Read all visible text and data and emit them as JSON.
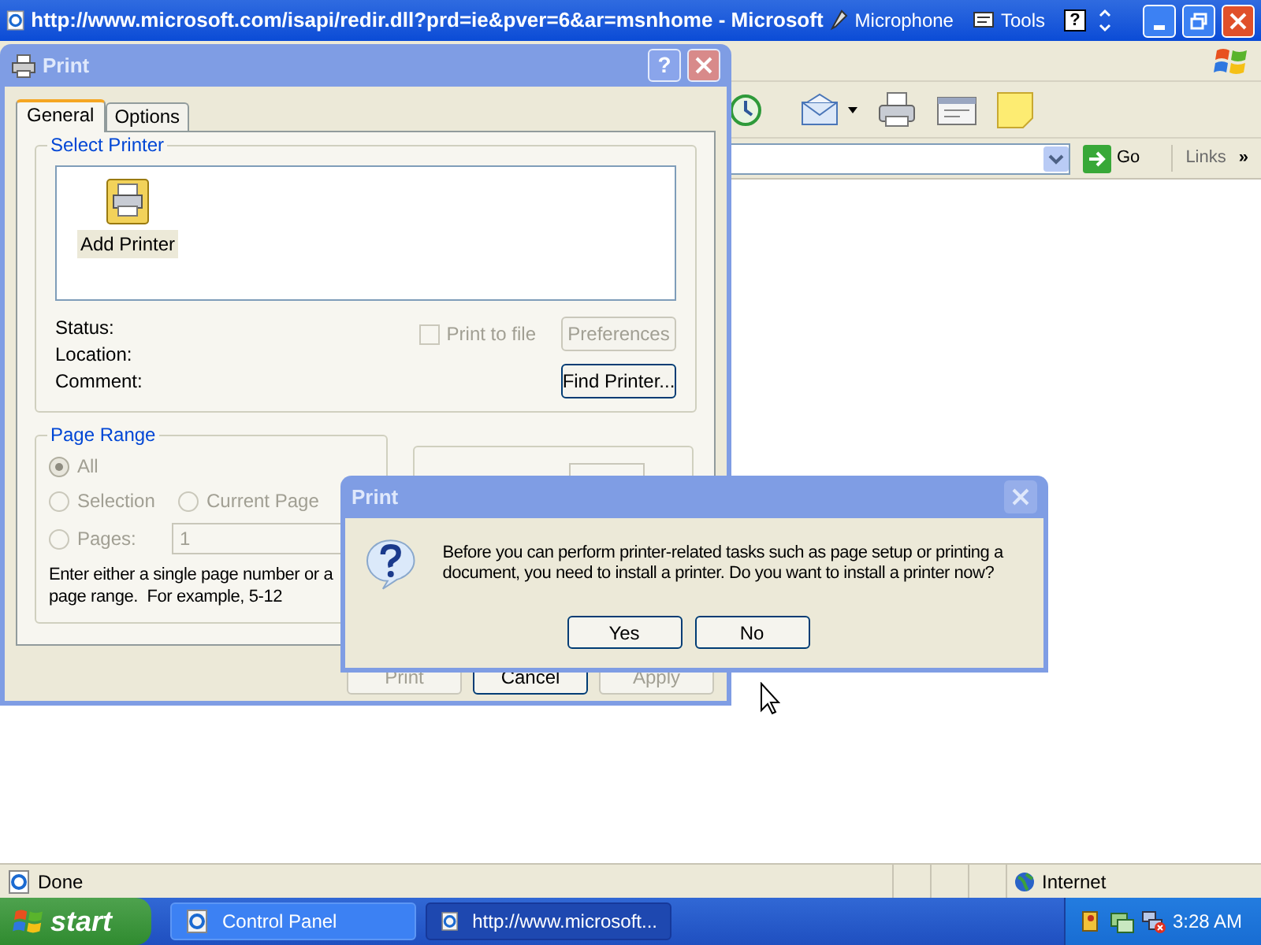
{
  "browser": {
    "title": "http://www.microsoft.com/isapi/redir.dll?prd=ie&pver=6&ar=msnhome - Microsoft",
    "language_bar": {
      "microphone": "Microphone",
      "tools": "Tools",
      "help": "?"
    },
    "address": {
      "go": "Go",
      "links": "Links",
      "more": "»"
    }
  },
  "status_bar": {
    "text": "Done",
    "zone": "Internet"
  },
  "print_dialog": {
    "title": "Print",
    "help": "?",
    "tabs": [
      {
        "label": "General",
        "selected": true
      },
      {
        "label": "Options",
        "selected": false
      }
    ],
    "select_printer": {
      "heading": "Select Printer",
      "printers": [
        {
          "label": "Add Printer",
          "selected": false
        }
      ]
    },
    "info_labels": [
      "Status:",
      "Location:",
      "Comment:"
    ],
    "print_to_file": {
      "label": "Print to file",
      "checked": false,
      "disabled": true
    },
    "preferences": {
      "label": "Preferences",
      "disabled": true
    },
    "find_printer": {
      "label": "Find Printer...",
      "disabled": false
    },
    "page_range": {
      "heading": "Page Range",
      "options": [
        {
          "label": "All",
          "selected": true
        },
        {
          "label": "Selection",
          "selected": false
        },
        {
          "label": "Current Page",
          "selected": false
        },
        {
          "label": "Pages:",
          "selected": false
        }
      ],
      "pages_value": "1",
      "hint": "Enter either a single page number or a page range.  For example, 5-12"
    },
    "buttons": [
      {
        "label": "Print",
        "disabled": true
      },
      {
        "label": "Cancel",
        "disabled": false
      },
      {
        "label": "Apply",
        "disabled": true
      }
    ]
  },
  "message_box": {
    "title": "Print",
    "text": "Before you can perform printer-related tasks such as page setup or printing a document, you need to install a printer. Do you want to install a printer now?",
    "buttons": [
      "Yes",
      "No"
    ]
  },
  "taskbar": {
    "start": "start",
    "tasks": [
      {
        "label": "Control Panel",
        "selected": false
      },
      {
        "label": "http://www.microsoft...",
        "selected": true
      }
    ],
    "clock": "3:28 AM"
  }
}
